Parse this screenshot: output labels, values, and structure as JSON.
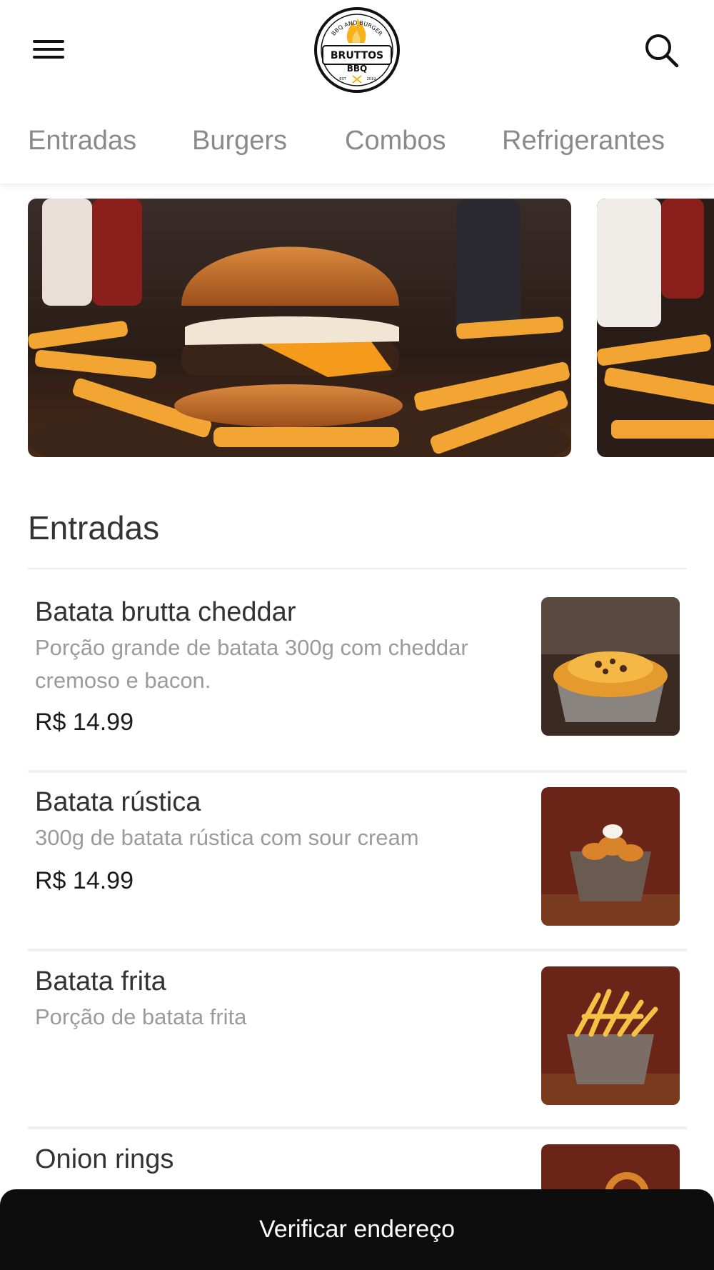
{
  "header": {
    "menu_icon": "hamburger-menu-icon",
    "search_icon": "search-icon",
    "logo": {
      "arc_text": "BBQ AND BURGER",
      "brand_line1": "BRUTTOS",
      "brand_line2": "BBQ",
      "est": "EST",
      "year": "2019",
      "accent": "#f5b21b"
    }
  },
  "tabs": [
    {
      "label": "Entradas"
    },
    {
      "label": "Burgers"
    },
    {
      "label": "Combos"
    },
    {
      "label": "Refrigerantes"
    }
  ],
  "section": {
    "title": "Entradas",
    "items": [
      {
        "name": "Batata brutta cheddar",
        "description": "Porção grande de batata 300g com cheddar cremoso e bacon.",
        "price": "R$ 14.99"
      },
      {
        "name": "Batata rústica",
        "description": "300g de batata rústica com sour cream",
        "price": "R$ 14.99"
      },
      {
        "name": "Batata frita",
        "description": "Porção de batata frita",
        "price": ""
      },
      {
        "name": "Onion rings",
        "description": "",
        "price": ""
      }
    ]
  },
  "cta": {
    "label": "Verificar endereço"
  },
  "colors": {
    "cta_bg": "#0d0d0d",
    "tab_text": "#8a8a8a",
    "logo_accent": "#f5b21b"
  }
}
